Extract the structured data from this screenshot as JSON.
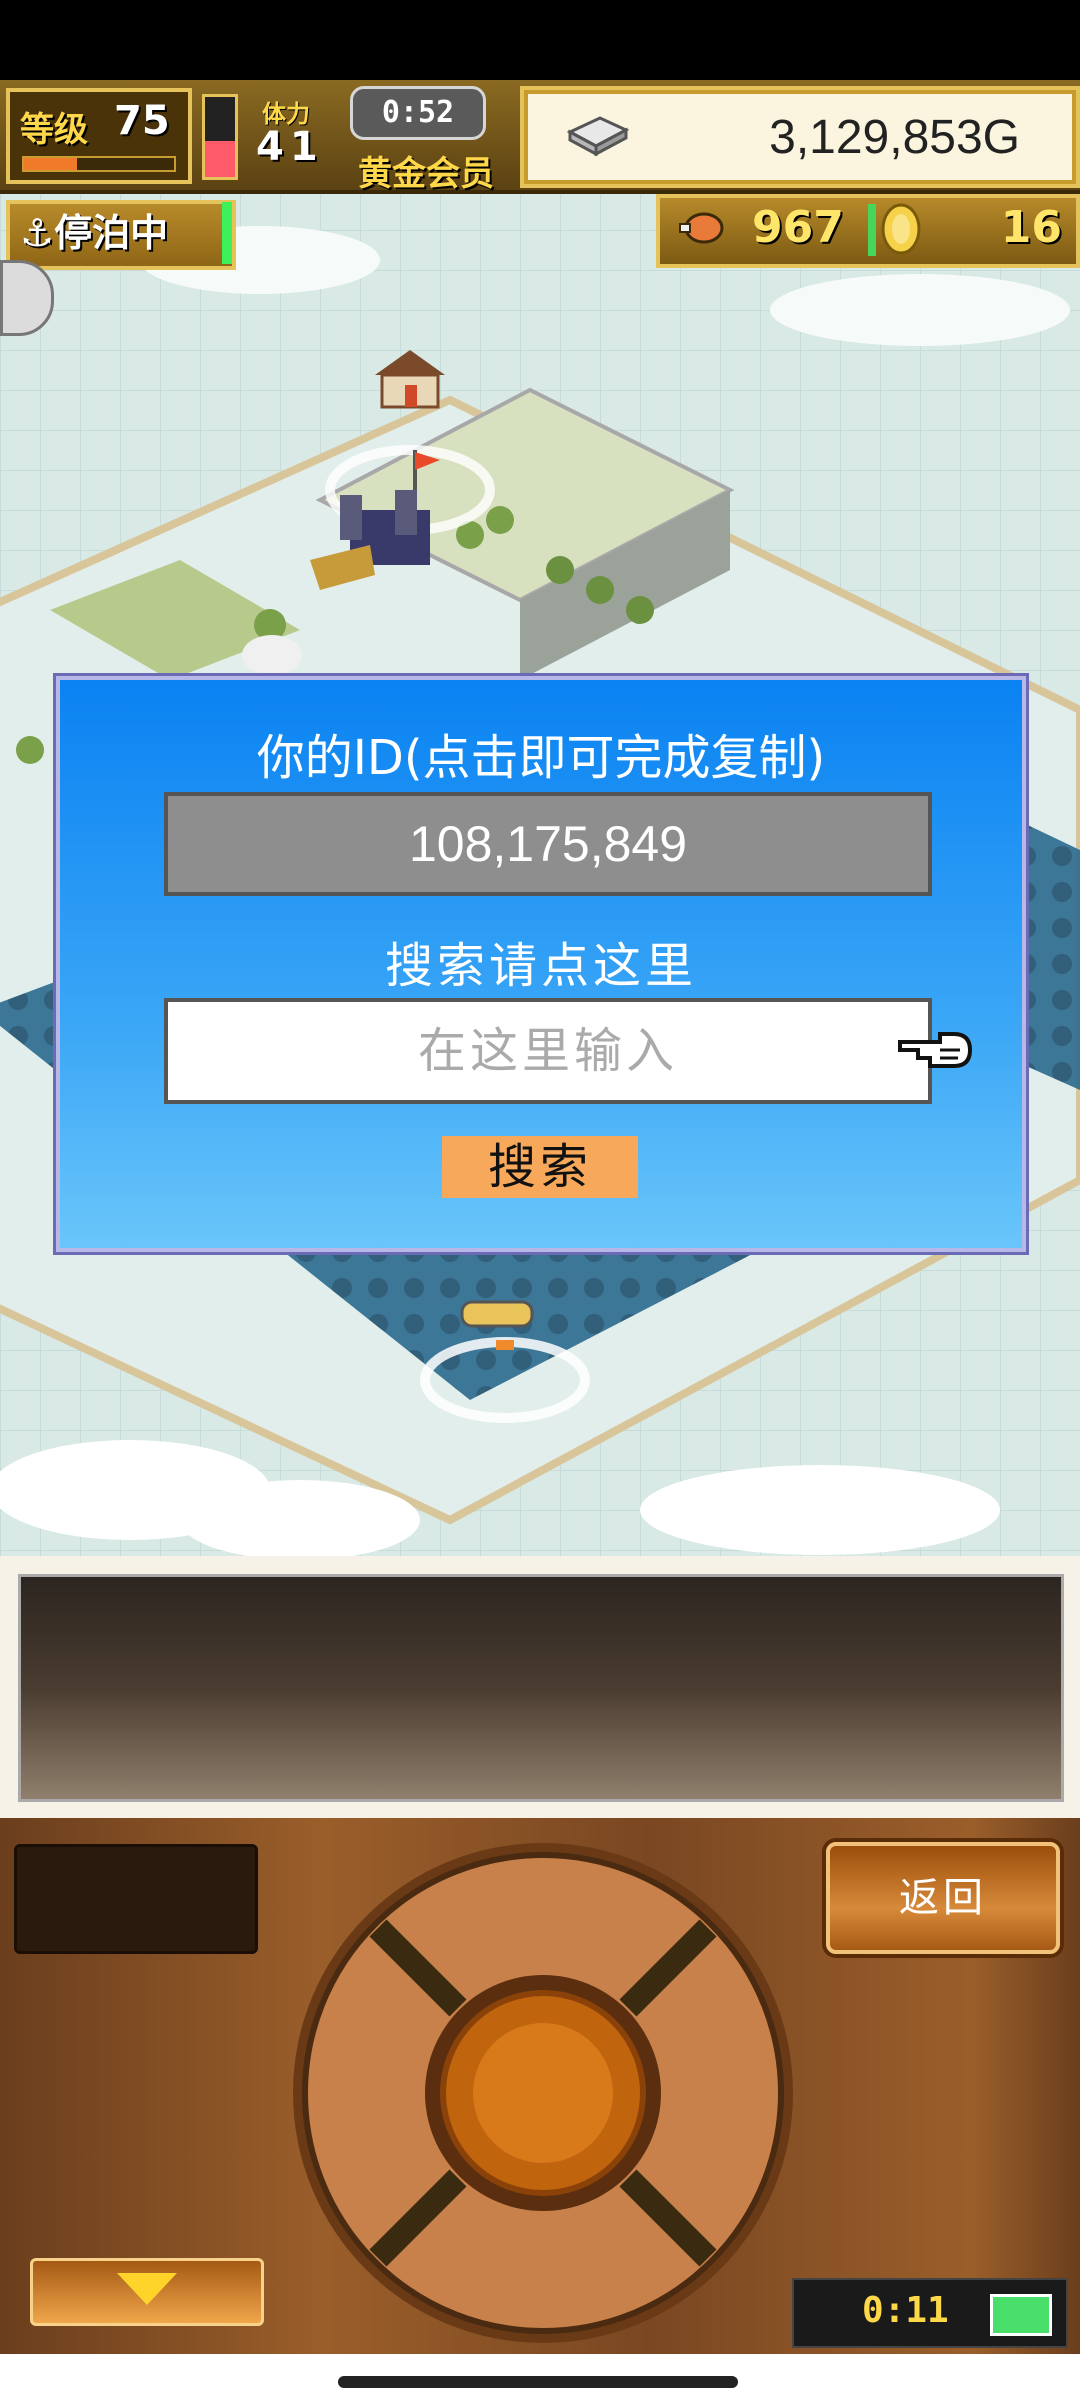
{
  "hud": {
    "level_label": "等级",
    "level_value": "75",
    "level_progress": 0.35,
    "stamina_fill": 0.45,
    "stamina_label": "体力",
    "stamina_value": "41",
    "timer": "0:52",
    "membership": "黄金会员",
    "money": "3,129,853G",
    "status": "停泊中",
    "food": "967",
    "coins": "16"
  },
  "dialog": {
    "title": "你的ID(点击即可完成复制)",
    "id_value": "108,175,849",
    "search_hint": "搜索请点这里",
    "input_placeholder": "在这里输入",
    "search_button": "搜索"
  },
  "controls": {
    "back_button": "返回",
    "clock": "0:11"
  },
  "colors": {
    "dialog_bg": "#0a82f2",
    "search_button_bg": "#f7a85a",
    "id_box_bg": "#8e8e8e",
    "hud_gold": "#e6c35a"
  }
}
